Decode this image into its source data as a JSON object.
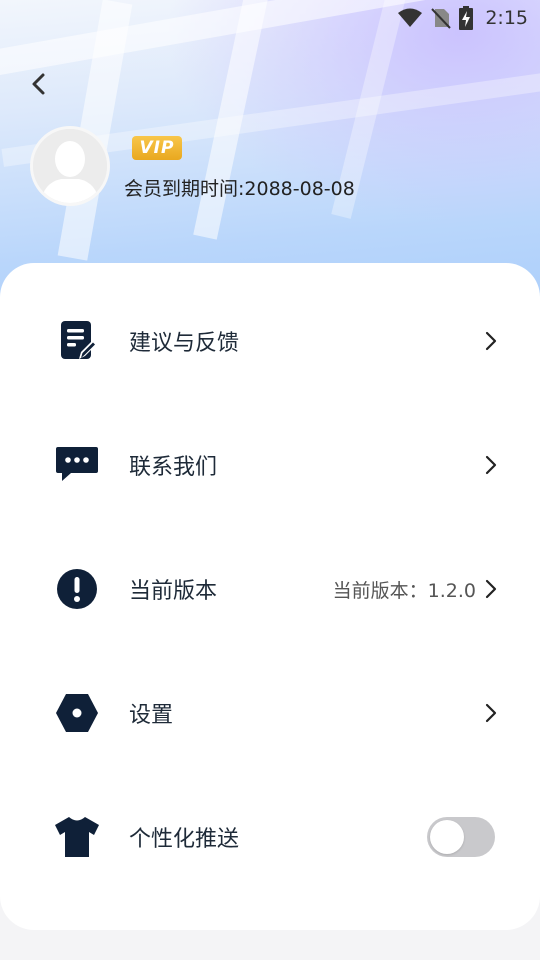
{
  "status_bar": {
    "time": "2:15",
    "icons": [
      "wifi-icon",
      "no-sim-icon",
      "battery-charging-icon"
    ]
  },
  "header": {
    "back_icon": "chevron-left-icon",
    "avatar_icon": "default-user-avatar",
    "vip_badge": "VIP",
    "expiry_text": "会员到期时间:2088-08-08"
  },
  "menu": {
    "items": [
      {
        "label": "建议与反馈",
        "icon": "feedback-edit-icon",
        "value": ""
      },
      {
        "label": "联系我们",
        "icon": "chat-bubble-icon",
        "value": ""
      },
      {
        "label": "当前版本",
        "icon": "exclamation-circle-icon",
        "value": "当前版本：1.2.0"
      },
      {
        "label": "设置",
        "icon": "hexagon-settings-icon",
        "value": ""
      },
      {
        "label": "个性化推送",
        "icon": "tshirt-icon",
        "value": "",
        "toggle_on": false
      }
    ]
  },
  "colors": {
    "icon_dark": "#0f2038",
    "vip_gold": "#f2b531",
    "toggle_off": "#c9c9cc"
  }
}
